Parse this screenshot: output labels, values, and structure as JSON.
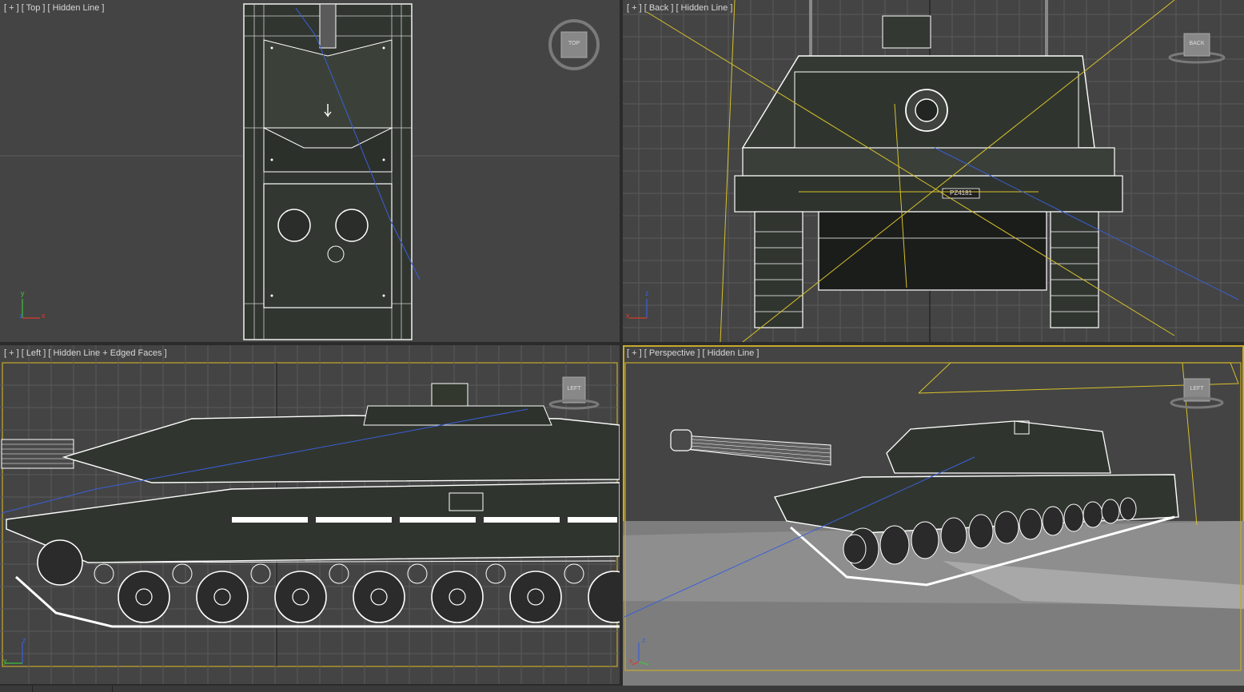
{
  "viewports": {
    "top": {
      "label": "[ + ] [ Top ] [ Hidden Line ]",
      "viewcube": "TOP"
    },
    "back": {
      "label": "[ + ] [ Back ] [ Hidden Line ]",
      "viewcube": "BACK"
    },
    "left": {
      "label": "[ + ] [ Left ] [ Hidden Line + Edged Faces ]",
      "viewcube": "LEFT"
    },
    "persp": {
      "label": "[ + ] [ Perspective ] [ Hidden Line ]",
      "viewcube": "LEFT"
    }
  },
  "axes": {
    "x": "x",
    "y": "y",
    "z": "z"
  },
  "plate_text": "PZ4181",
  "colors": {
    "viewport_bg": "#444444",
    "grid": "#595959",
    "wire": "#ffffff",
    "hull": "#2e332c",
    "active_border": "#c7a92b",
    "light_cone": "#d8c12a",
    "axis_x": "#d83a2a",
    "axis_y": "#3fc23f",
    "axis_z": "#3a5fd8"
  }
}
